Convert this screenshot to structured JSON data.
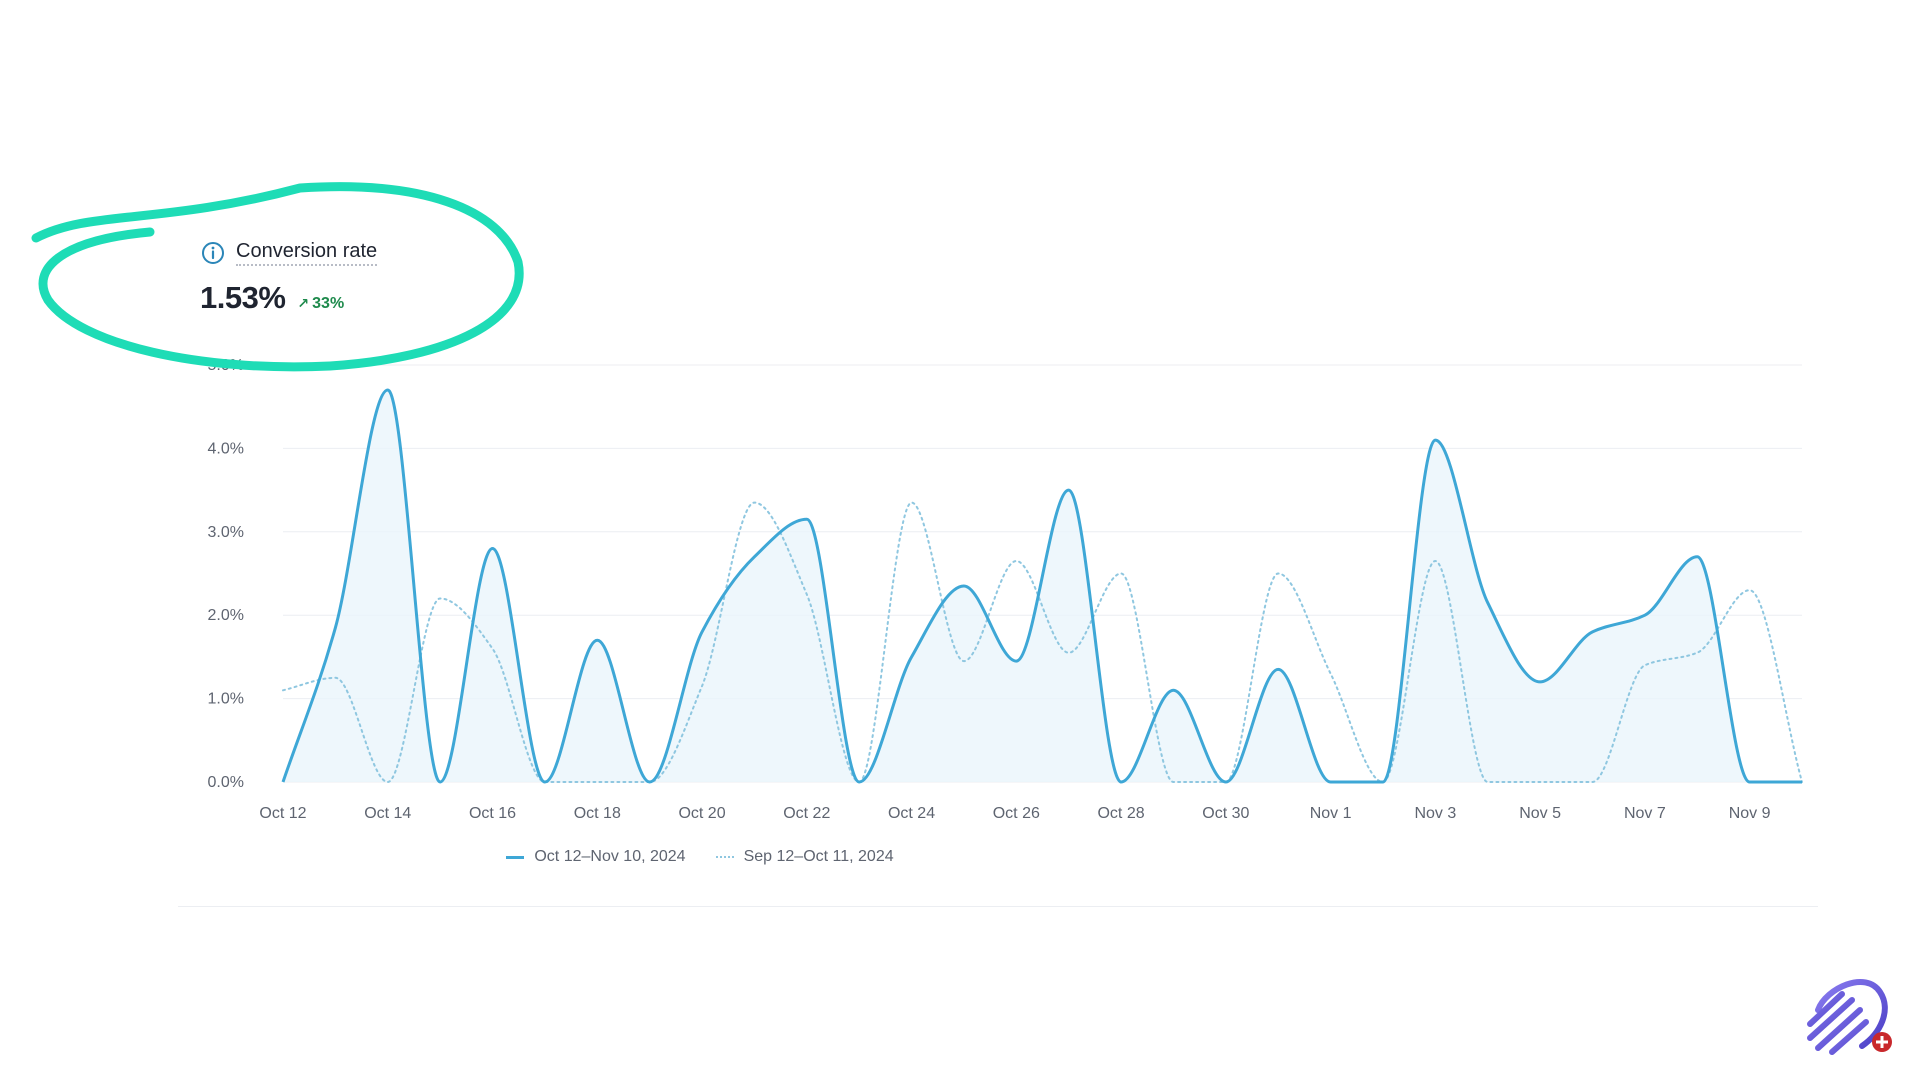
{
  "metric": {
    "title": "Conversion rate",
    "value": "1.53%",
    "change": "33%",
    "change_color": "#1e8a4c",
    "info_icon": "info-circle-icon",
    "icon_color": "#2b86b8"
  },
  "colors": {
    "current_series": "#3ea7d6",
    "previous_series": "#8fc7e0",
    "fill": "#eaf5fb",
    "grid": "#eceef2",
    "annotation": "#1edcb6"
  },
  "chart_data": {
    "type": "line",
    "ylim": [
      0,
      5
    ],
    "y_ticks": [
      "0.0%",
      "1.0%",
      "2.0%",
      "3.0%",
      "4.0%",
      "5.0%"
    ],
    "x_tick_labels": [
      "Oct 12",
      "Oct 14",
      "Oct 16",
      "Oct 18",
      "Oct 20",
      "Oct 22",
      "Oct 24",
      "Oct 26",
      "Oct 28",
      "Oct 30",
      "Nov 1",
      "Nov 3",
      "Nov 5",
      "Nov 7",
      "Nov 9"
    ],
    "x": [
      "Oct 12",
      "Oct 13",
      "Oct 14",
      "Oct 15",
      "Oct 16",
      "Oct 17",
      "Oct 18",
      "Oct 19",
      "Oct 20",
      "Oct 21",
      "Oct 22",
      "Oct 23",
      "Oct 24",
      "Oct 25",
      "Oct 26",
      "Oct 27",
      "Oct 28",
      "Oct 29",
      "Oct 30",
      "Oct 31",
      "Nov 1",
      "Nov 2",
      "Nov 3",
      "Nov 4",
      "Nov 5",
      "Nov 6",
      "Nov 7",
      "Nov 8",
      "Nov 9",
      "Nov 10"
    ],
    "grid": true,
    "legend_position": "bottom-center",
    "series": [
      {
        "name": "Oct 12–Nov 10, 2024",
        "style": "solid",
        "values": [
          0,
          1.85,
          4.7,
          0,
          2.8,
          0,
          1.7,
          0,
          1.8,
          2.7,
          3.15,
          0,
          1.5,
          2.35,
          1.45,
          3.5,
          0,
          1.1,
          0,
          1.35,
          0,
          0,
          4.1,
          2.15,
          1.2,
          1.8,
          2.0,
          2.7,
          0,
          0
        ]
      },
      {
        "name": "Sep 12–Oct 11, 2024",
        "style": "dotted",
        "values": [
          1.1,
          1.25,
          0,
          2.2,
          1.6,
          0,
          0,
          0,
          1.15,
          3.35,
          2.25,
          0,
          3.35,
          1.45,
          2.65,
          1.55,
          2.5,
          0,
          0,
          2.5,
          1.3,
          0,
          2.65,
          0,
          0,
          0,
          1.4,
          1.55,
          2.3,
          0
        ]
      }
    ]
  }
}
